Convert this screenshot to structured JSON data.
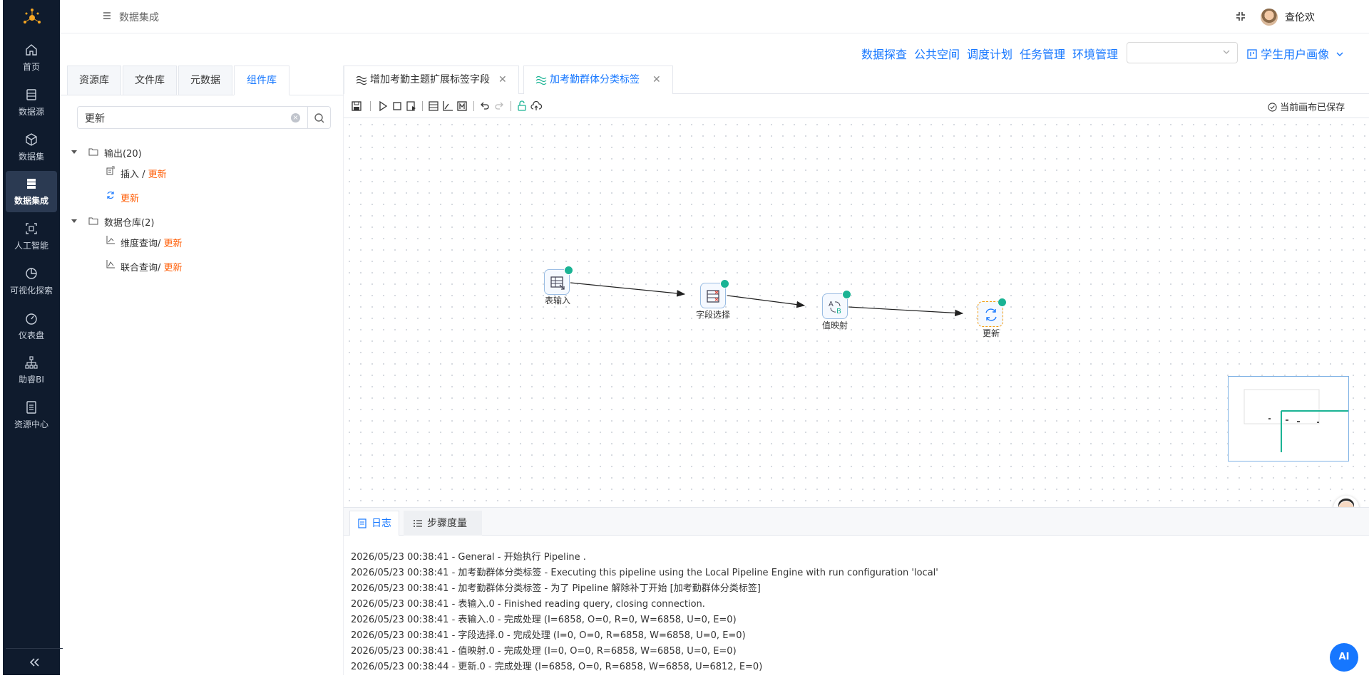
{
  "nav": {
    "items": [
      {
        "label": "首页",
        "icon": "home-icon"
      },
      {
        "label": "数据源",
        "icon": "database-icon"
      },
      {
        "label": "数据集",
        "icon": "cube-icon"
      },
      {
        "label": "数据集成",
        "icon": "server-icon",
        "active": true
      },
      {
        "label": "人工智能",
        "icon": "ai-icon"
      },
      {
        "label": "可视化探索",
        "icon": "pie-chart-icon"
      },
      {
        "label": "仪表盘",
        "icon": "gauge-icon"
      },
      {
        "label": "助睿BI",
        "icon": "org-chart-icon"
      },
      {
        "label": "资源中心",
        "icon": "resource-icon"
      }
    ]
  },
  "header": {
    "title": "数据集成",
    "username": "查伦欢"
  },
  "toplinks": [
    "数据探查",
    "公共空间",
    "调度计划",
    "任务管理",
    "环境管理"
  ],
  "env_select": {
    "value": ""
  },
  "project": "学生用户画像",
  "left_tabs": [
    {
      "label": "资源库"
    },
    {
      "label": "文件库"
    },
    {
      "label": "元数据"
    },
    {
      "label": "组件库",
      "active": true
    }
  ],
  "search": {
    "value": "更新"
  },
  "tree": {
    "group1": {
      "label": "输出",
      "count": "(20)"
    },
    "item1": {
      "prefix": "插入 / ",
      "highlight": "更新"
    },
    "item2": {
      "prefix": "",
      "highlight": "更新"
    },
    "group2": {
      "label": "数据仓库",
      "count": "(2)"
    },
    "item3": {
      "prefix": "维度查询/ ",
      "highlight": "更新"
    },
    "item4": {
      "prefix": "联合查询/ ",
      "highlight": "更新"
    }
  },
  "editor_tabs": [
    {
      "label": "增加考勤主题扩展标签字段",
      "active": false
    },
    {
      "label": "加考勤群体分类标签",
      "active": true
    }
  ],
  "toolbar": {
    "saved_status": "当前画布已保存"
  },
  "pipeline": {
    "nodes": [
      {
        "label": "表输入",
        "icon": "table-input-icon"
      },
      {
        "label": "字段选择",
        "icon": "field-select-icon"
      },
      {
        "label": "值映射",
        "icon": "value-mapping-icon"
      },
      {
        "label": "更新",
        "icon": "refresh-icon",
        "selected": true
      }
    ]
  },
  "log_tabs": [
    {
      "label": "日志",
      "active": true
    },
    {
      "label": "步骤度量",
      "active": false
    }
  ],
  "log": [
    "2026/05/23 00:38:41 - General - 开始执行 Pipeline .",
    "2026/05/23 00:38:41 - 加考勤群体分类标签 - Executing this pipeline using the Local Pipeline Engine with run configuration 'local'",
    "2026/05/23 00:38:41 - 加考勤群体分类标签 - 为了 Pipeline 解除补丁开始 [加考勤群体分类标签]",
    "2026/05/23 00:38:41 - 表输入.0 - Finished reading query, closing connection.",
    "2026/05/23 00:38:41 - 表输入.0 - 完成处理 (I=6858, O=0, R=0, W=6858, U=0, E=0)",
    "2026/05/23 00:38:41 - 字段选择.0 - 完成处理 (I=0, O=0, R=6858, W=6858, U=0, E=0)",
    "2026/05/23 00:38:41 - 值映射.0 - 完成处理 (I=0, O=0, R=6858, W=6858, U=0, E=0)",
    "2026/05/23 00:38:44 - 更新.0 - 完成处理 (I=6858, O=0, R=6858, W=6858, U=6812, E=0)"
  ],
  "ai_button": "AI",
  "colors": {
    "accent": "#1677ff",
    "highlight": "#ff5a00",
    "nav_bg": "#0f1b2d",
    "success": "#1ab394"
  }
}
